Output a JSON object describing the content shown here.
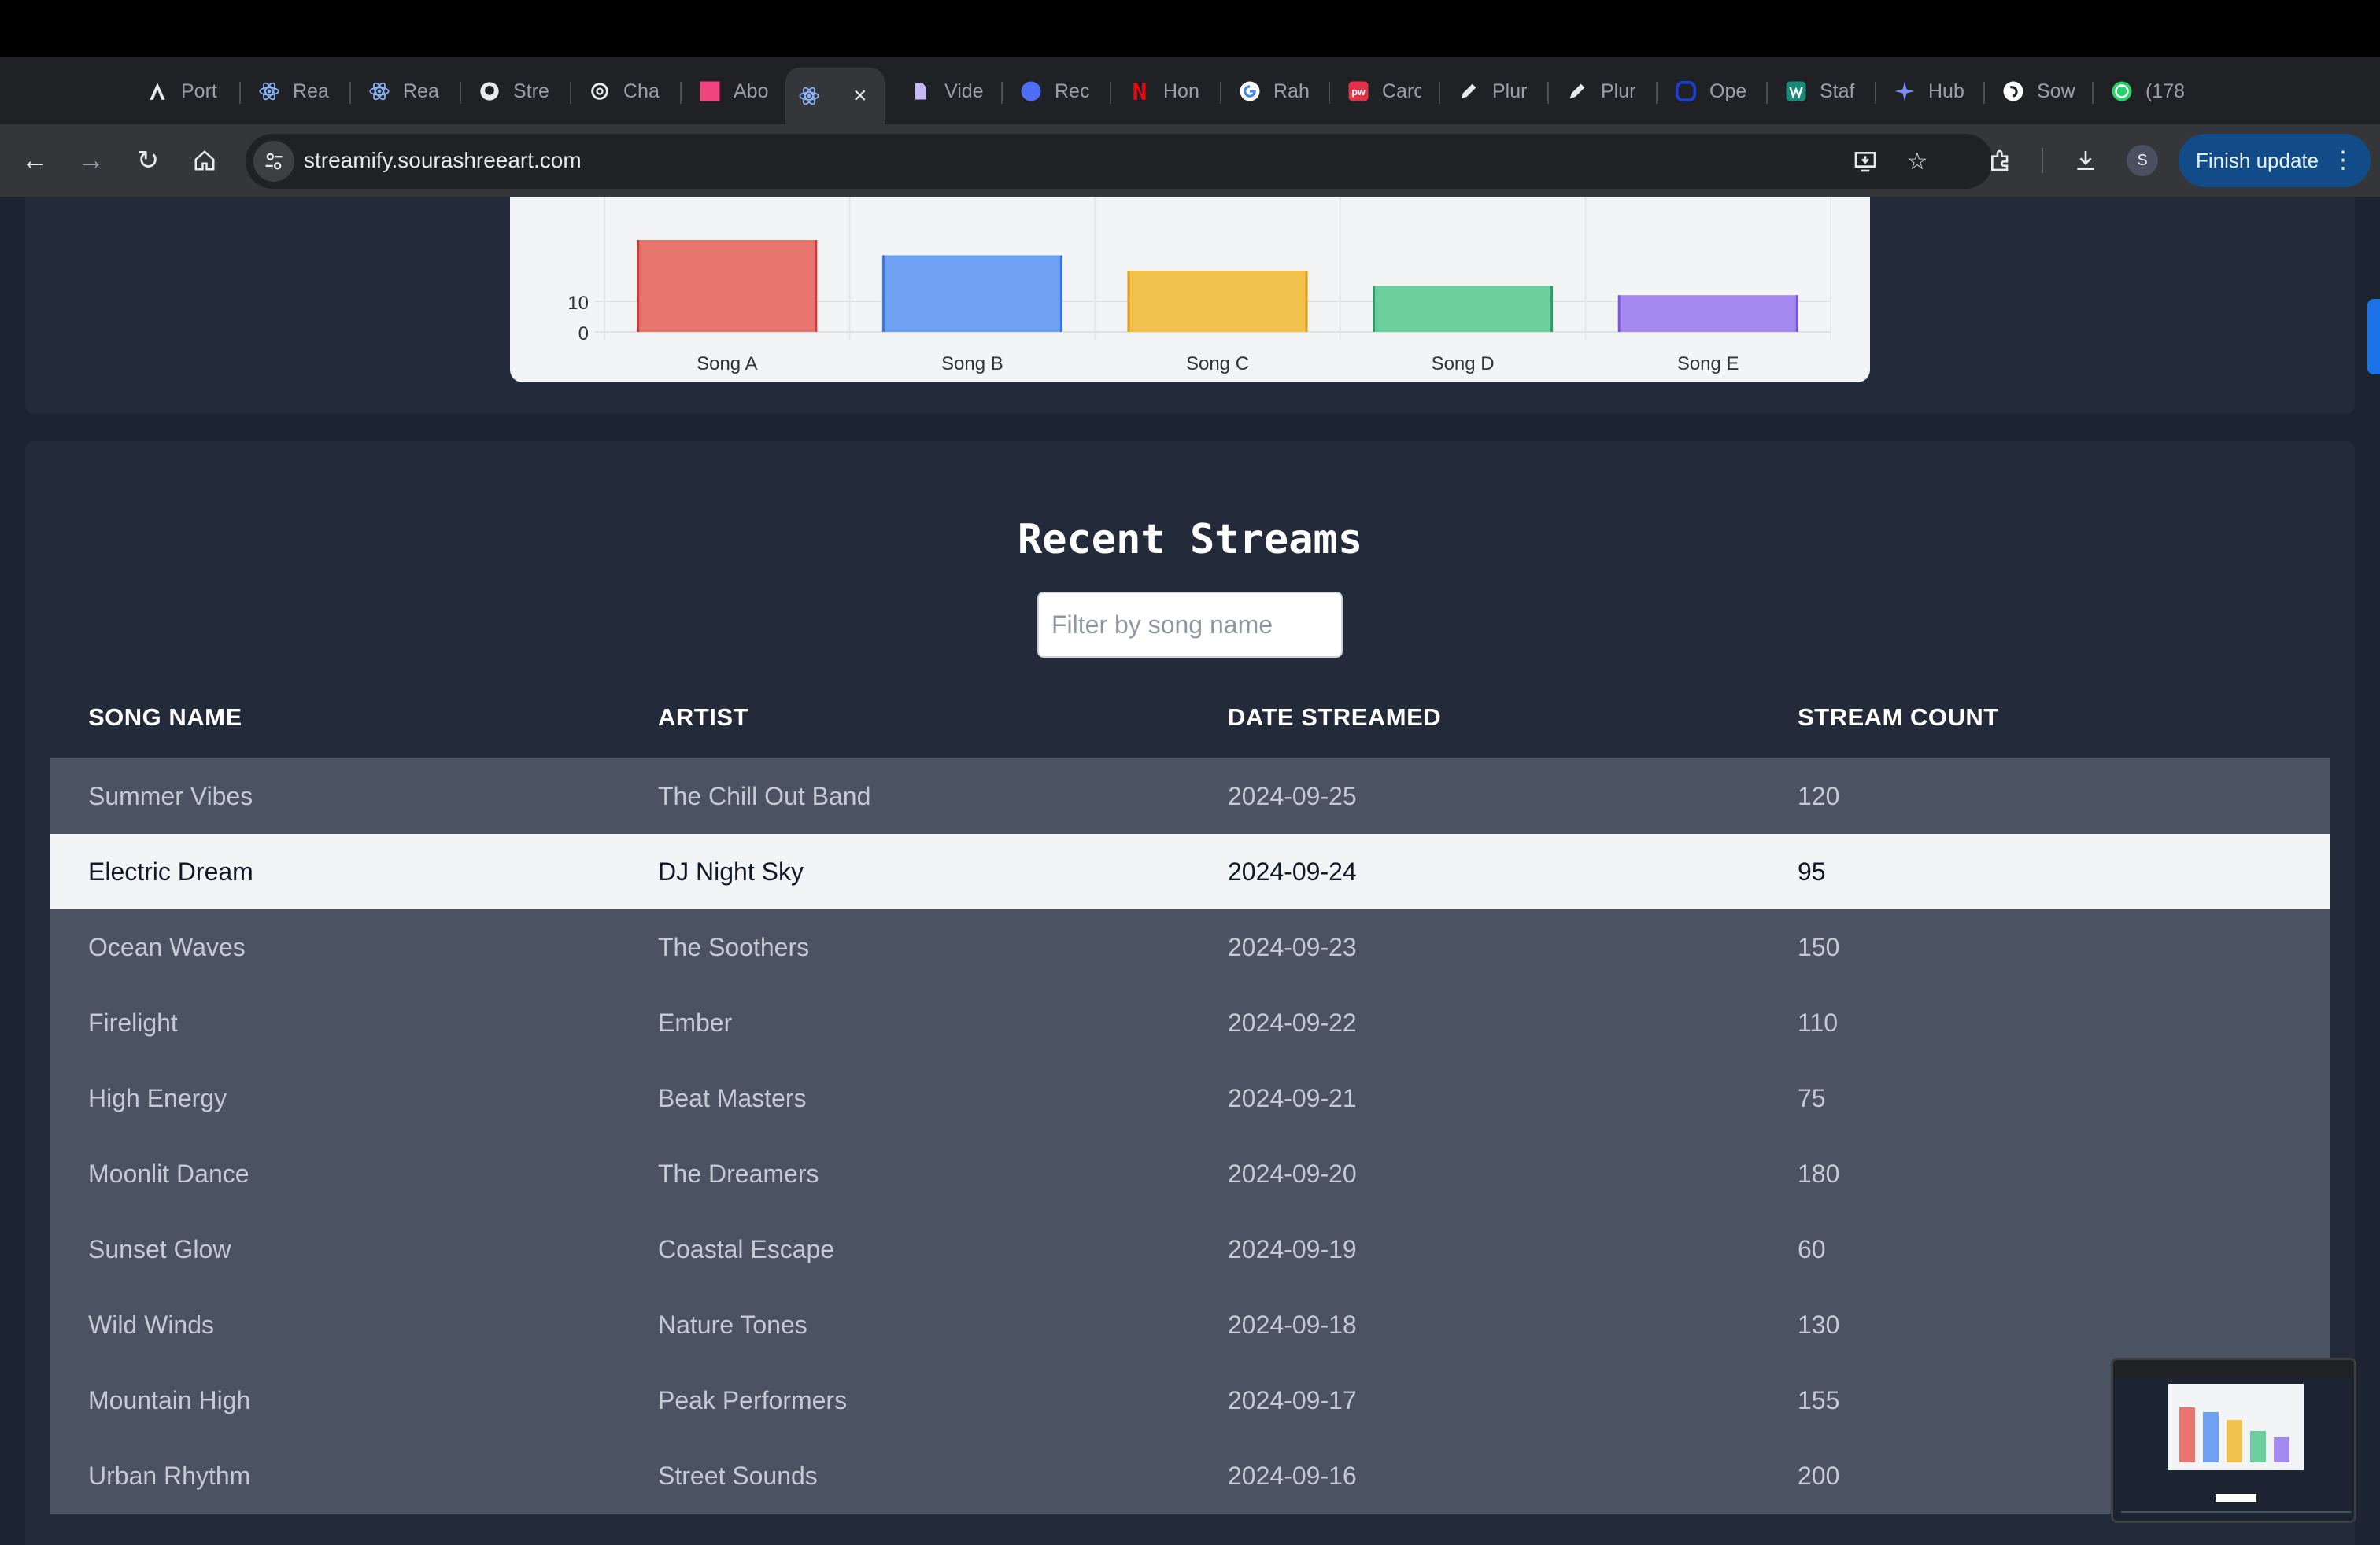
{
  "browser": {
    "tabs": [
      {
        "title": "Port",
        "icon": "angular-icon"
      },
      {
        "title": "Rea",
        "icon": "react-icon"
      },
      {
        "title": "Rea",
        "icon": "react-icon"
      },
      {
        "title": "Stre",
        "icon": "github-icon"
      },
      {
        "title": "Cha",
        "icon": "openai-icon"
      },
      {
        "title": "Abo",
        "icon": "pink-square-icon"
      },
      {
        "title": "",
        "icon": "react-icon",
        "active": true
      },
      {
        "title": "Vide",
        "icon": "video-icon"
      },
      {
        "title": "Rec",
        "icon": "blue-circle-icon"
      },
      {
        "title": "Hon",
        "icon": "netflix-icon"
      },
      {
        "title": "Rah",
        "icon": "google-icon"
      },
      {
        "title": "Carc",
        "icon": "pw-icon"
      },
      {
        "title": "Plur",
        "icon": "pen-icon"
      },
      {
        "title": "Plur",
        "icon": "pen-icon"
      },
      {
        "title": "Ope",
        "icon": "open-icon"
      },
      {
        "title": "Staf",
        "icon": "staff-icon"
      },
      {
        "title": "Hub",
        "icon": "sparkle-icon"
      },
      {
        "title": "Sow",
        "icon": "sow-icon"
      },
      {
        "title": "(178",
        "icon": "whatsapp-icon"
      }
    ],
    "url": "streamify.sourashreeart.com",
    "avatar_letter": "S",
    "finish_update_label": "Finish update"
  },
  "chart_data": {
    "type": "bar",
    "categories": [
      "Song A",
      "Song B",
      "Song C",
      "Song D",
      "Song E"
    ],
    "values": [
      30,
      25,
      20,
      15,
      12
    ],
    "colors": [
      "#e8766f",
      "#6ea1f2",
      "#f2c14c",
      "#6ccf9e",
      "#a48af0"
    ],
    "borders": [
      "#d33a35",
      "#3d74e6",
      "#e09a17",
      "#2f9d6b",
      "#7b55e0"
    ],
    "visible_ticks": [
      0,
      10
    ]
  },
  "streams": {
    "title": "Recent Streams",
    "filter_placeholder": "Filter by song name",
    "columns": [
      "SONG NAME",
      "ARTIST",
      "DATE STREAMED",
      "STREAM COUNT"
    ],
    "rows": [
      [
        "Summer Vibes",
        "The Chill Out Band",
        "2024-09-25",
        "120"
      ],
      [
        "Electric Dream",
        "DJ Night Sky",
        "2024-09-24",
        "95"
      ],
      [
        "Ocean Waves",
        "The Soothers",
        "2024-09-23",
        "150"
      ],
      [
        "Firelight",
        "Ember",
        "2024-09-22",
        "110"
      ],
      [
        "High Energy",
        "Beat Masters",
        "2024-09-21",
        "75"
      ],
      [
        "Moonlit Dance",
        "The Dreamers",
        "2024-09-20",
        "180"
      ],
      [
        "Sunset Glow",
        "Coastal Escape",
        "2024-09-19",
        "60"
      ],
      [
        "Wild Winds",
        "Nature Tones",
        "2024-09-18",
        "130"
      ],
      [
        "Mountain High",
        "Peak Performers",
        "2024-09-17",
        "155"
      ],
      [
        "Urban Rhythm",
        "Street Sounds",
        "2024-09-16",
        "200"
      ]
    ],
    "highlighted_row": 1
  }
}
